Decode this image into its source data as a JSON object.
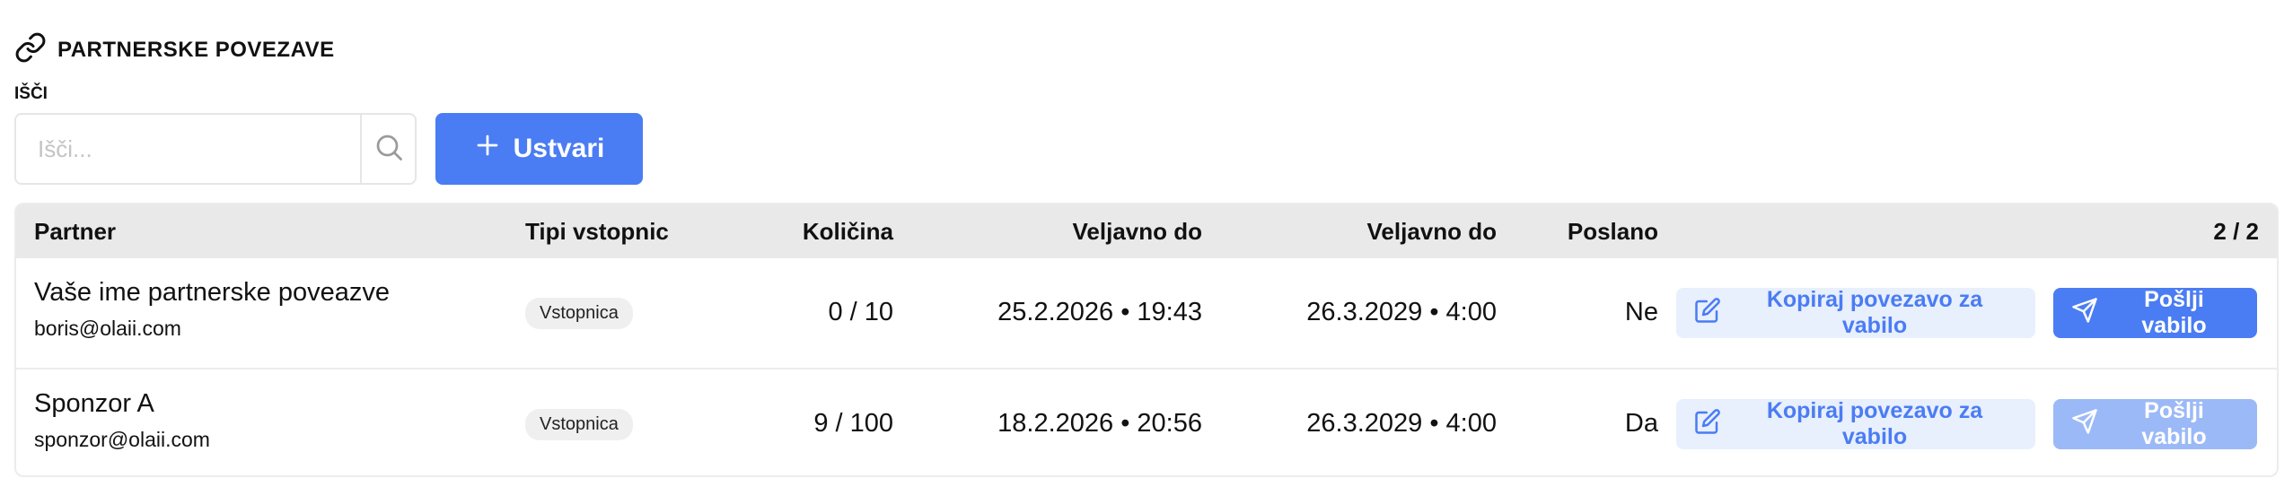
{
  "section": {
    "title": "PARTNERSKE POVEZAVE",
    "icon": "link-icon"
  },
  "search": {
    "label": "IŠČI",
    "placeholder": "Išči...",
    "value": "",
    "icon": "search-icon"
  },
  "create_button": {
    "label": "Ustvari",
    "icon": "plus-icon",
    "color": "#4a7cf3"
  },
  "table": {
    "headers": {
      "partner": "Partner",
      "ticket_types": "Tipi vstopnic",
      "quantity": "Količina",
      "valid_to_1": "Veljavno do",
      "valid_to_2": "Veljavno do",
      "sent": "Poslano",
      "count": "2 / 2"
    },
    "rows": [
      {
        "name": "Vaše ime partnerske poveazve",
        "email": "boris@olaii.com",
        "ticket_type": "Vstopnica",
        "quantity": "0 / 10",
        "valid_to_1": "25.2.2026 • 19:43",
        "valid_to_2": "26.3.2029 • 4:00",
        "sent": "Ne",
        "copy_label": "Kopiraj povezavo za vabilo",
        "send_label": "Pošlji vabilo",
        "send_disabled": false
      },
      {
        "name": "Sponzor A",
        "email": "sponzor@olaii.com",
        "ticket_type": "Vstopnica",
        "quantity": "9 / 100",
        "valid_to_1": "18.2.2026 • 20:56",
        "valid_to_2": "26.3.2029 • 4:00",
        "sent": "Da",
        "copy_label": "Kopiraj povezavo za vabilo",
        "send_label": "Pošlji vabilo",
        "send_disabled": true
      }
    ]
  },
  "colors": {
    "accent": "#4a7cf3",
    "accent_light": "#e8effd",
    "accent_disabled": "#9cb9f7",
    "header_bg": "#e9e9e9"
  }
}
